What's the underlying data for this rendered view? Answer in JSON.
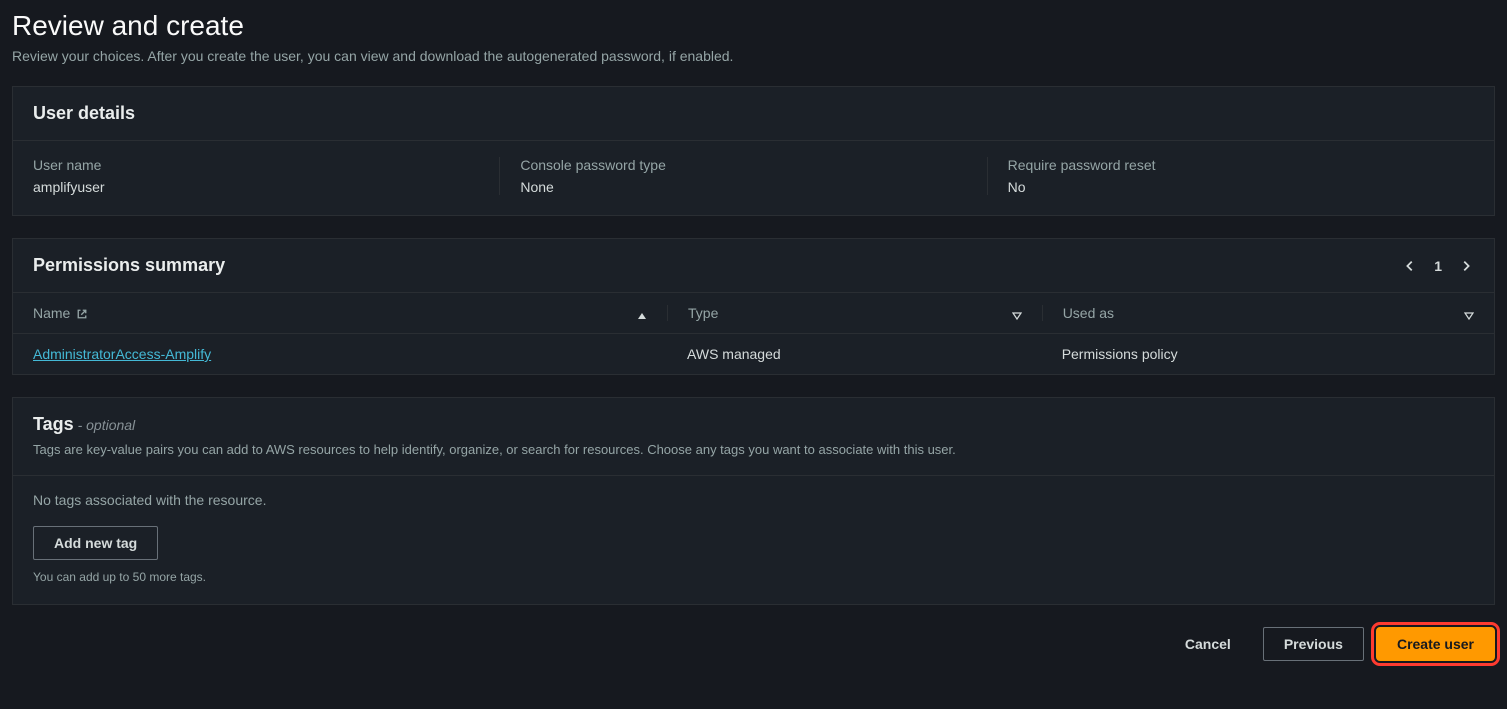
{
  "page": {
    "title": "Review and create",
    "subtitle": "Review your choices. After you create the user, you can view and download the autogenerated password, if enabled."
  },
  "user_details": {
    "panel_title": "User details",
    "fields": {
      "username_label": "User name",
      "username_value": "amplifyuser",
      "password_type_label": "Console password type",
      "password_type_value": "None",
      "reset_label": "Require password reset",
      "reset_value": "No"
    }
  },
  "permissions": {
    "panel_title": "Permissions summary",
    "pager_page": "1",
    "columns": {
      "name": "Name",
      "type": "Type",
      "used_as": "Used as"
    },
    "rows": [
      {
        "name": "AdministratorAccess-Amplify",
        "type": "AWS managed",
        "used_as": "Permissions policy"
      }
    ]
  },
  "tags": {
    "panel_title": "Tags",
    "optional_suffix": " - optional",
    "description": "Tags are key-value pairs you can add to AWS resources to help identify, organize, or search for resources. Choose any tags you want to associate with this user.",
    "empty_text": "No tags associated with the resource.",
    "add_button": "Add new tag",
    "helper": "You can add up to 50 more tags."
  },
  "footer": {
    "cancel": "Cancel",
    "previous": "Previous",
    "create": "Create user"
  }
}
